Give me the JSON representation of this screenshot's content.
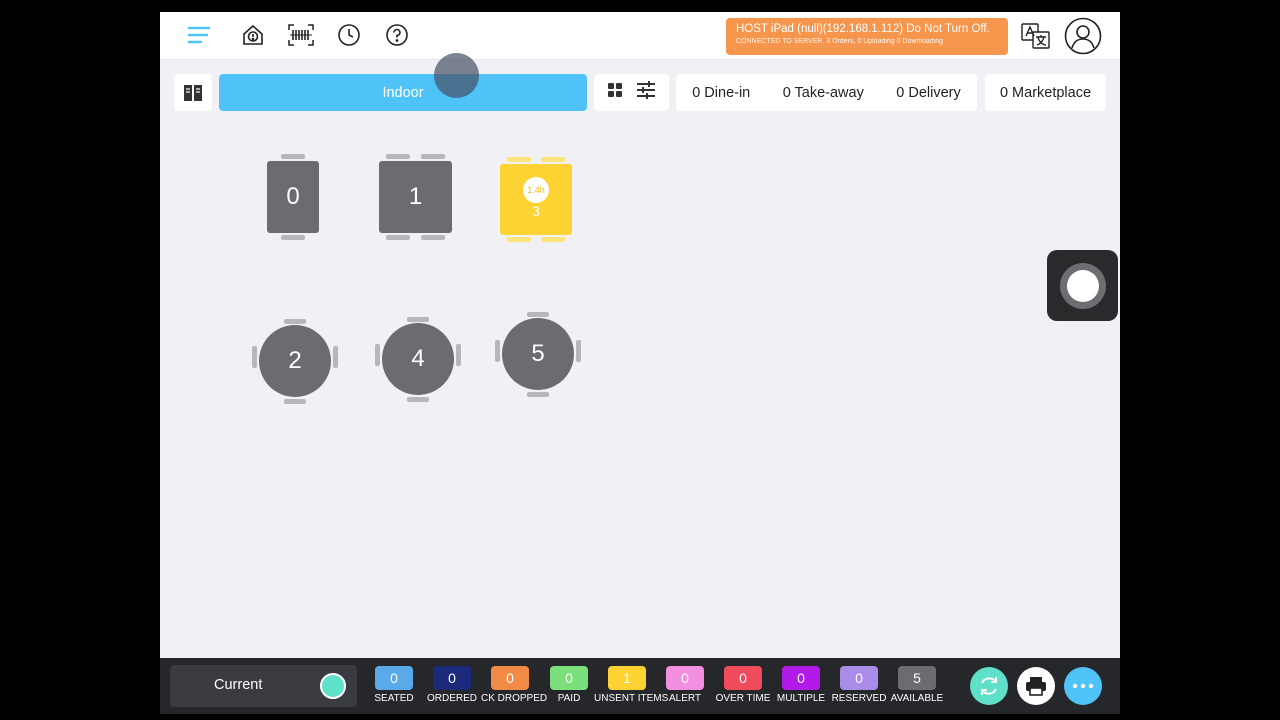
{
  "header": {
    "host_line1": "HOST iPad (null)(192.168.1.112) Do Not Turn Off.",
    "host_line2": "CONNECTED TO SERVER. 3 Orders, 0 Uploading 0 Downloading",
    "icons": [
      "menu-icon",
      "home-alert-icon",
      "barcode-icon",
      "clock-icon",
      "help-icon",
      "translate-icon",
      "user-icon"
    ],
    "accent": "#4fc3f7",
    "banner_color": "#f6954c"
  },
  "toolbar": {
    "area_tab": "Indoor",
    "dine_in": "0 Dine-in",
    "take_away": "0 Take-away",
    "delivery": "0 Delivery",
    "marketplace": "0 Marketplace"
  },
  "tables": [
    {
      "label": "0",
      "shape": "rect",
      "status": "available"
    },
    {
      "label": "1",
      "shape": "rect",
      "status": "available"
    },
    {
      "label": "3",
      "shape": "rect",
      "status": "unsent-items",
      "time": "1.4h"
    },
    {
      "label": "2",
      "shape": "round",
      "status": "available"
    },
    {
      "label": "4",
      "shape": "round",
      "status": "available"
    },
    {
      "label": "5",
      "shape": "round",
      "status": "available"
    }
  ],
  "bottom": {
    "current_label": "Current",
    "legend": [
      {
        "count": "0",
        "label": "SEATED",
        "color": "#5aa9e8"
      },
      {
        "count": "0",
        "label": "ORDERED",
        "color": "#1b2a7a"
      },
      {
        "count": "0",
        "label": "CK DROPPED",
        "color": "#f08a44"
      },
      {
        "count": "0",
        "label": "PAID",
        "color": "#7be07b"
      },
      {
        "count": "1",
        "label": "UNSENT ITEMS",
        "color": "#fdd233"
      },
      {
        "count": "0",
        "label": "ALERT",
        "color": "#f38ee0"
      },
      {
        "count": "0",
        "label": "OVER TIME",
        "color": "#ef4b5a"
      },
      {
        "count": "0",
        "label": "MULTIPLE",
        "color": "#b11ae8"
      },
      {
        "count": "0",
        "label": "RESERVED",
        "color": "#a98ce8"
      },
      {
        "count": "5",
        "label": "AVAILABLE",
        "color": "#6b6b70"
      }
    ]
  }
}
